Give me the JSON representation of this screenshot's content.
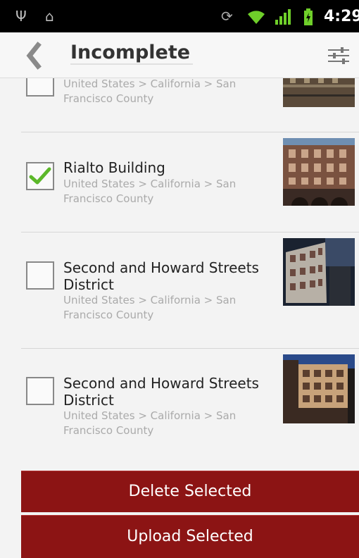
{
  "status_bar": {
    "time": "4:29",
    "icons": [
      "usb-icon",
      "android-icon",
      "sync-icon",
      "wifi-icon",
      "signal-icon",
      "battery-icon"
    ]
  },
  "header": {
    "title": "Incomplete",
    "back_icon": "chevron-left-icon",
    "filter_icon": "sliders-icon"
  },
  "items": [
    {
      "title": "",
      "subtitle": "United States > California > San Francisco County",
      "checked": false
    },
    {
      "title": "Rialto Building",
      "subtitle": "United States > California > San Francisco County",
      "checked": true
    },
    {
      "title": "Second and Howard Streets District",
      "subtitle": "United States > California > San Francisco County",
      "checked": false
    },
    {
      "title": "Second and Howard Streets District",
      "subtitle": "United States > California > San Francisco County",
      "checked": false
    }
  ],
  "actions": {
    "delete_label": "Delete Selected",
    "upload_label": "Upload Selected"
  },
  "colors": {
    "accent": "#8c1414",
    "check": "#5cb82a"
  }
}
